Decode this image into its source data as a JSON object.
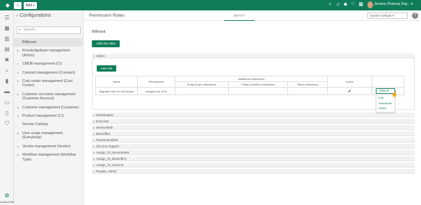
{
  "topbar": {
    "add_label": "Add +",
    "user_name": "Jovana (Testrou) Day... ▾",
    "icons": [
      "search-icon",
      "headset-icon",
      "tag-icon",
      "heart-icon",
      "calendar-icon"
    ]
  },
  "iconrail": {
    "icons": [
      "list-icon",
      "grid-icon",
      "building-icon",
      "calculator-icon",
      "contacts-icon",
      "search-icon",
      "chart-icon",
      "chat-icon",
      "document-icon",
      "phone-icon",
      "shield-icon"
    ],
    "settings_icon": "gear-icon",
    "status_text": "localhost:8080/#"
  },
  "sidebar": {
    "title": "Configurations",
    "back_icon": "chevron-left-icon",
    "search_placeholder": "Search...",
    "items": [
      {
        "label": "Billboard",
        "arrow": false,
        "active": true
      },
      {
        "label": "Knowledgebase management (Article)",
        "arrow": true
      },
      {
        "label": "CMDB management (CI)",
        "arrow": true
      },
      {
        "label": "Contract management (Contract)",
        "arrow": true
      },
      {
        "label": "Cost center management (Cost Center)",
        "arrow": true
      },
      {
        "label": "Customer accounts management (Customer Account)",
        "arrow": true
      },
      {
        "label": "Customer management (Customer)",
        "arrow": true
      },
      {
        "label": "Product management (CI)",
        "arrow": true
      },
      {
        "label": "Service Catalog",
        "arrow": false
      },
      {
        "label": "User scope management (Everybody)",
        "arrow": true
      },
      {
        "label": "Vendor management (Vendor)",
        "arrow": true
      },
      {
        "label": "Workflow management (Workflow Type)",
        "arrow": true
      }
    ]
  },
  "main": {
    "title": "Permission Rules",
    "tab": "ENTITY",
    "system_select": "System Default",
    "help": "?",
    "section_title": "Billboard",
    "add_rules_label": "Add role rules",
    "admin_group": "Admin",
    "add_role_label": "Add role",
    "table": {
      "headers": {
        "name": "Name",
        "permissions": "Permissions",
        "additional": "Additional restrictions",
        "entity_scope": "Entity scope restrictions",
        "entity_condition": "Entity condition restrictions",
        "other": "Other restrictions",
        "active": "Active"
      },
      "row": {
        "name": "Migrated rule for role Admin",
        "permissions": "Assigned (6 of 9)",
        "entity_scope": "",
        "entity_condition": "",
        "other": "",
        "active": "✔"
      }
    },
    "view_label": "View",
    "dropdown": [
      "Edit",
      "Deactivate",
      "Delete"
    ],
    "groups": [
      "GlobalAgent",
      "End User",
      "Servicedesk",
      "Backoffice",
      "Parent backfide",
      "3rd Line Support",
      "Assign_To_Servicedesk",
      "Assign_To_Backoffice",
      "Assign_To_2ndLine",
      "People_Admin"
    ]
  },
  "colors": {
    "brand": "#0f7c5a"
  }
}
